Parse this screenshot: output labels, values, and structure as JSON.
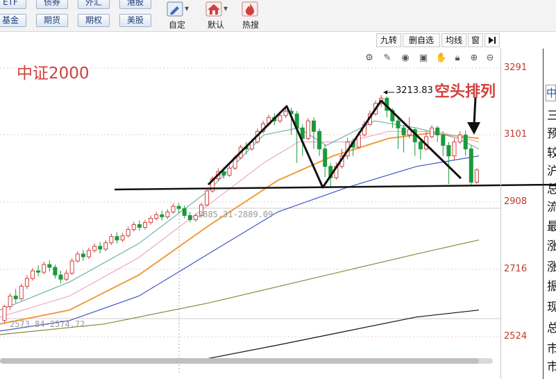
{
  "toolbar": {
    "quick_buttons": [
      {
        "label": "ETF",
        "row": 0
      },
      {
        "label": "债券",
        "row": 0
      },
      {
        "label": "外汇",
        "row": 0
      },
      {
        "label": "港股",
        "row": 0
      },
      {
        "label": "基金",
        "row": 1
      },
      {
        "label": "期货",
        "row": 1
      },
      {
        "label": "期权",
        "row": 1
      },
      {
        "label": "美股",
        "row": 1
      }
    ],
    "tools": [
      {
        "label": "自定",
        "icon": "edit-icon"
      },
      {
        "label": "默认",
        "icon": "home-icon"
      },
      {
        "label": "热搜",
        "icon": "hot-search-icon"
      }
    ]
  },
  "chart_tabs": [
    "九转",
    "删自选",
    "均线",
    "窗"
  ],
  "chart": {
    "index_name": "中证2000",
    "pattern_label": "空头排列",
    "peak_label": "3213.83",
    "range_label_1": "2885.31-2889.09",
    "range_label_2": "2573.84-2574.72",
    "price_ticks": [
      "3291",
      "3101",
      "2908",
      "2716",
      "2524"
    ]
  },
  "side_panel_chars": [
    "三",
    "预",
    "较",
    "沪",
    "总",
    "流",
    "最",
    "涨",
    "涨",
    "振",
    "现",
    "总",
    "市",
    "市"
  ],
  "side_tab_char": "中",
  "colors": {
    "up": "#d0413e",
    "down": "#1a9a3a",
    "ma5": "#333333",
    "ma10": "#6fb0a8",
    "ma20": "#e8a8c8",
    "ma30": "#f09b3a",
    "ma60": "#3f55c6",
    "ma120": "#8a8a3a",
    "ma250": "#111111"
  },
  "chart_data": {
    "type": "candlestick",
    "ylim": [
      2500,
      3320
    ],
    "y_ticks": [
      3291,
      3101,
      2908,
      2716,
      2524
    ],
    "annotations": [
      "3213.83",
      "2885.31-2889.09",
      "2573.84-2574.72",
      "空头排列",
      "中证2000"
    ],
    "candles": [
      [
        2570,
        2610,
        2562,
        2615
      ],
      [
        2610,
        2640,
        2600,
        2648
      ],
      [
        2640,
        2632,
        2620,
        2660
      ],
      [
        2632,
        2668,
        2628,
        2675
      ],
      [
        2668,
        2690,
        2660,
        2700
      ],
      [
        2690,
        2712,
        2684,
        2720
      ],
      [
        2712,
        2708,
        2696,
        2728
      ],
      [
        2708,
        2730,
        2702,
        2738
      ],
      [
        2730,
        2722,
        2710,
        2742
      ],
      [
        2722,
        2700,
        2690,
        2730
      ],
      [
        2700,
        2688,
        2676,
        2712
      ],
      [
        2688,
        2705,
        2682,
        2714
      ],
      [
        2705,
        2740,
        2700,
        2748
      ],
      [
        2740,
        2760,
        2735,
        2768
      ],
      [
        2760,
        2752,
        2740,
        2772
      ],
      [
        2752,
        2770,
        2746,
        2778
      ],
      [
        2770,
        2782,
        2764,
        2790
      ],
      [
        2782,
        2774,
        2762,
        2794
      ],
      [
        2774,
        2792,
        2768,
        2800
      ],
      [
        2792,
        2810,
        2786,
        2818
      ],
      [
        2810,
        2800,
        2790,
        2822
      ],
      [
        2800,
        2812,
        2794,
        2820
      ],
      [
        2812,
        2830,
        2808,
        2838
      ],
      [
        2830,
        2844,
        2824,
        2852
      ],
      [
        2844,
        2836,
        2826,
        2856
      ],
      [
        2836,
        2850,
        2830,
        2858
      ],
      [
        2850,
        2862,
        2844,
        2870
      ],
      [
        2862,
        2872,
        2856,
        2880
      ],
      [
        2872,
        2866,
        2856,
        2884
      ],
      [
        2866,
        2880,
        2860,
        2888
      ],
      [
        2880,
        2896,
        2874,
        2904
      ],
      [
        2896,
        2890,
        2876,
        2906
      ],
      [
        2890,
        2870,
        2862,
        2898
      ],
      [
        2870,
        2858,
        2850,
        2880
      ],
      [
        2858,
        2870,
        2852,
        2876
      ],
      [
        2870,
        2900,
        2866,
        2906
      ],
      [
        2900,
        2940,
        2896,
        2946
      ],
      [
        2940,
        2975,
        2935,
        2982
      ],
      [
        2975,
        2995,
        2968,
        3004
      ],
      [
        2995,
        2985,
        2975,
        3008
      ],
      [
        2985,
        3005,
        2980,
        3012
      ],
      [
        3005,
        3035,
        3000,
        3042
      ],
      [
        3035,
        3065,
        3030,
        3072
      ],
      [
        3065,
        3060,
        3045,
        3080
      ],
      [
        3060,
        3080,
        3055,
        3088
      ],
      [
        3080,
        3110,
        3075,
        3118
      ],
      [
        3110,
        3132,
        3104,
        3140
      ],
      [
        3132,
        3150,
        3126,
        3158
      ],
      [
        3150,
        3140,
        3128,
        3162
      ],
      [
        3140,
        3155,
        3134,
        3160
      ],
      [
        3155,
        3168,
        3148,
        3175
      ],
      [
        3168,
        3160,
        3100,
        3178
      ],
      [
        3160,
        3120,
        3020,
        3168
      ],
      [
        3120,
        3090,
        3040,
        3130
      ],
      [
        3090,
        3140,
        3085,
        3148
      ],
      [
        3140,
        3110,
        3060,
        3150
      ],
      [
        3110,
        3060,
        3040,
        3118
      ],
      [
        3060,
        3010,
        2980,
        3072
      ],
      [
        3010,
        2978,
        2950,
        3020
      ],
      [
        2978,
        3010,
        2972,
        3022
      ],
      [
        3010,
        3040,
        3004,
        3060
      ],
      [
        3040,
        3080,
        3030,
        3092
      ],
      [
        3080,
        3065,
        3040,
        3090
      ],
      [
        3065,
        3100,
        3060,
        3110
      ],
      [
        3100,
        3130,
        3095,
        3140
      ],
      [
        3130,
        3160,
        3125,
        3170
      ],
      [
        3160,
        3190,
        3155,
        3198
      ],
      [
        3190,
        3205,
        3180,
        3214
      ],
      [
        3205,
        3170,
        3150,
        3210
      ],
      [
        3170,
        3140,
        3120,
        3176
      ],
      [
        3140,
        3120,
        3060,
        3150
      ],
      [
        3120,
        3100,
        3050,
        3128
      ],
      [
        3100,
        3115,
        3090,
        3150
      ],
      [
        3115,
        3080,
        3040,
        3120
      ],
      [
        3080,
        3060,
        3030,
        3090
      ],
      [
        3060,
        3095,
        3055,
        3110
      ],
      [
        3095,
        3120,
        3090,
        3128
      ],
      [
        3120,
        3100,
        3080,
        3126
      ],
      [
        3100,
        3070,
        3040,
        3110
      ],
      [
        3070,
        3040,
        2960,
        3080
      ],
      [
        3040,
        3080,
        3030,
        3090
      ],
      [
        3080,
        3100,
        3075,
        3110
      ],
      [
        3100,
        3060,
        3040,
        3112
      ],
      [
        3060,
        2965,
        2955,
        3070
      ],
      [
        2965,
        3000,
        2960,
        3005
      ]
    ]
  }
}
